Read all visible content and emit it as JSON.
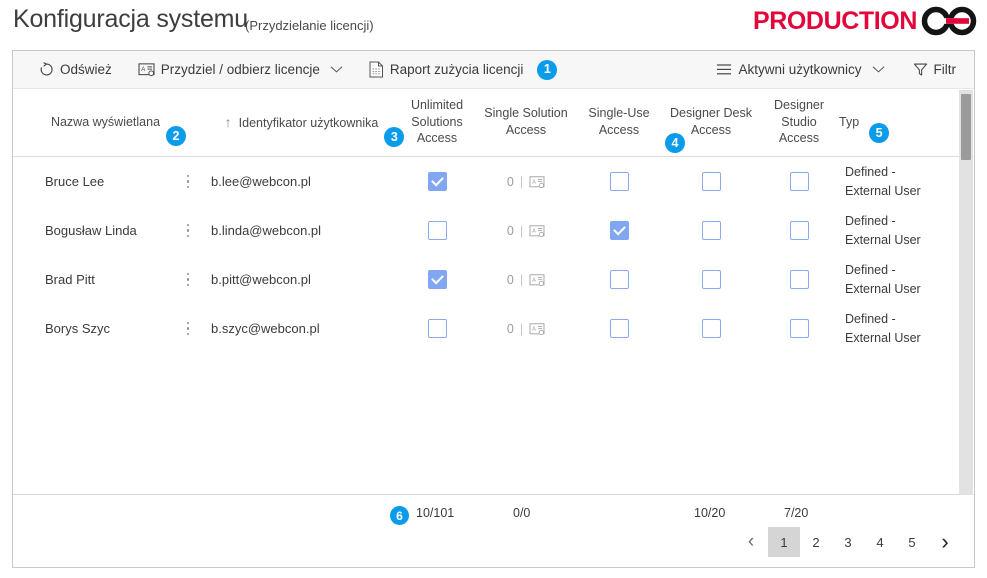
{
  "window": {
    "title": "Konfiguracja systemu",
    "subtitle": "(Przydzielanie licencji)"
  },
  "logo": {
    "text": "PRODUCTION",
    "icon": "chain-link-icon",
    "color": "#e2063a"
  },
  "toolbar": {
    "refresh": {
      "label": "Odśwież",
      "icon": "refresh-icon"
    },
    "assign": {
      "label": "Przydziel / odbierz licencje",
      "icon": "user-card-icon",
      "chevron": "∨"
    },
    "report": {
      "label": "Raport zużycia licencji",
      "icon": "document-icon",
      "badge": "1"
    },
    "users_filter": {
      "label": "Aktywni użytkownicy",
      "icon": "hamburger-icon",
      "chevron": "∨"
    },
    "filter": {
      "label": "Filtr",
      "icon": "funnel-icon"
    }
  },
  "grid": {
    "columns": [
      {
        "key": "name",
        "label": "Nazwa wyświetlana",
        "badge": "2"
      },
      {
        "key": "login",
        "label": "Identyfikator użytkownika",
        "badge": "3",
        "sorted": "asc",
        "sort_icon": "arrow-up-icon"
      },
      {
        "key": "unlimited",
        "label": "Unlimited Solutions Access",
        "badge": null
      },
      {
        "key": "single_solution",
        "label": "Single Solution Access",
        "badge": null
      },
      {
        "key": "single_use",
        "label": "Single-Use Access",
        "badge": "4"
      },
      {
        "key": "designer_desk",
        "label": "Designer Desk Access",
        "badge": null
      },
      {
        "key": "designer_studio",
        "label": "Designer Studio Access",
        "badge": null
      },
      {
        "key": "type",
        "label": "Typ",
        "badge": "5"
      }
    ],
    "rows": [
      {
        "name": "Bruce Lee",
        "login": "b.lee@webcon.pl",
        "unlimited": true,
        "single_solution_count": "0",
        "single_use": false,
        "designer_desk": false,
        "designer_studio": false,
        "type": "Defined - External User"
      },
      {
        "name": "Bogusław Linda",
        "login": "b.linda@webcon.pl",
        "unlimited": false,
        "single_solution_count": "0",
        "single_use": true,
        "designer_desk": false,
        "designer_studio": false,
        "type": "Defined - External User"
      },
      {
        "name": "Brad Pitt",
        "login": "b.pitt@webcon.pl",
        "unlimited": true,
        "single_solution_count": "0",
        "single_use": false,
        "designer_desk": false,
        "designer_studio": false,
        "type": "Defined - External User"
      },
      {
        "name": "Borys Szyc",
        "login": "b.szyc@webcon.pl",
        "unlimited": false,
        "single_solution_count": "0",
        "single_use": false,
        "designer_desk": false,
        "designer_studio": false,
        "type": "Defined - External User"
      }
    ]
  },
  "footer": {
    "badge": "6",
    "totals": {
      "unlimited": "10/101",
      "single_solution": "0/0",
      "single_use": "10/20",
      "designer_desk": "7/20"
    },
    "pagination": {
      "prev": "‹",
      "next": "›",
      "pages": [
        "1",
        "2",
        "3",
        "4",
        "5"
      ],
      "current": "1"
    }
  },
  "colors": {
    "badge_blue": "#0a9ceb",
    "checkbox_on": "#82a7f2",
    "checkbox_border": "#8aa9ef",
    "brand_red": "#e2063a"
  }
}
